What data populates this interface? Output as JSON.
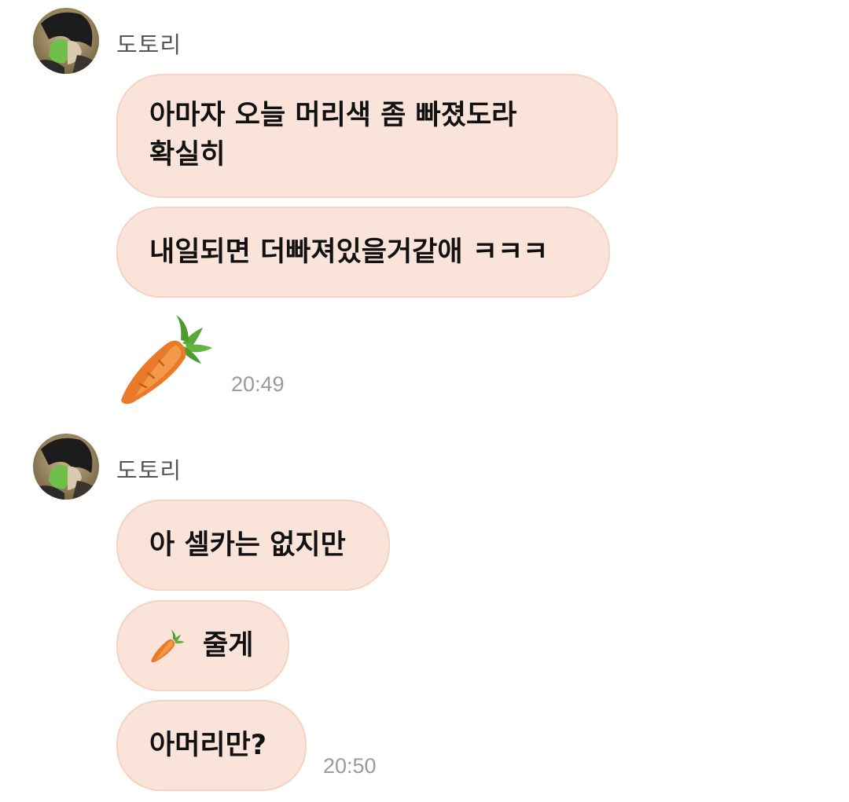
{
  "groups": [
    {
      "sender": "도토리",
      "avatar_icon": "profile-photo-avatar",
      "messages": [
        {
          "lines": [
            "아마자 오늘 머리색 좀 빠졌도라",
            "확실히"
          ]
        },
        {
          "text": "내일되면 더빠져있을거같애 ㅋㅋㅋ"
        },
        {
          "sticker": "carrot-icon"
        }
      ],
      "time": "20:49"
    },
    {
      "sender": "도토리",
      "avatar_icon": "profile-photo-avatar",
      "messages": [
        {
          "text": "아 셀카는 없지만"
        },
        {
          "emoji": "carrot-icon",
          "text": "줄게"
        },
        {
          "text": "아머리만?"
        }
      ],
      "time": "20:50"
    }
  ],
  "colors": {
    "bubble_fill": "#fae4da",
    "bubble_border": "#f4d3c3",
    "sender_text": "#555555",
    "time_text": "#9a9a9a"
  }
}
